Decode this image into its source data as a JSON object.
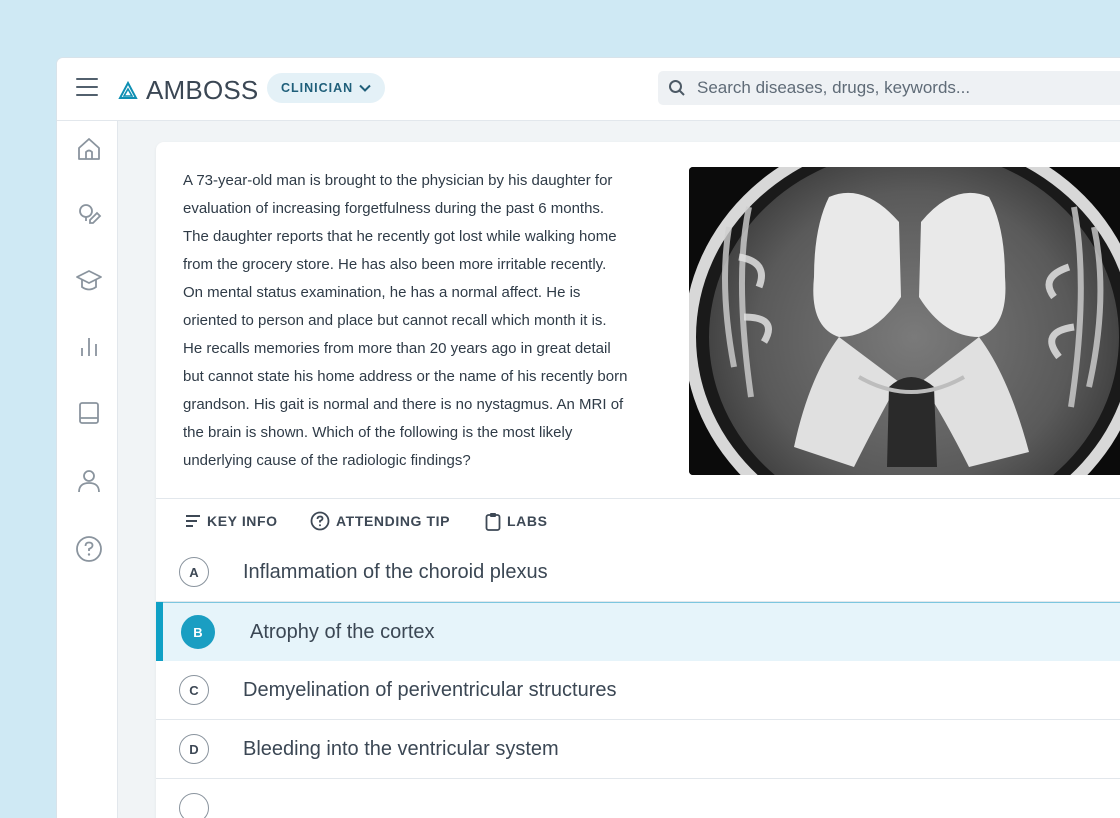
{
  "header": {
    "brand": "AMBOSS",
    "role": "CLINICIAN",
    "search_placeholder": "Search diseases, drugs, keywords..."
  },
  "sidebar": {
    "items": [
      {
        "icon": "home-icon"
      },
      {
        "icon": "stethoscope-icon"
      },
      {
        "icon": "graduation-cap-icon"
      },
      {
        "icon": "bar-chart-icon"
      },
      {
        "icon": "book-icon"
      },
      {
        "icon": "user-icon"
      },
      {
        "icon": "help-icon"
      }
    ]
  },
  "question": {
    "lines": [
      "A 73-year-old man is brought to the physician by his daughter for",
      "evaluation of increasing forgetfulness during the past 6 months.",
      "The daughter reports that he recently got lost while walking home",
      "from the grocery store. He has also been more irritable recently.",
      "On mental status examination, he has a normal affect. He is",
      "oriented to person and place but cannot recall which month it is.",
      "He recalls memories from more than 20 years ago in great detail",
      "but cannot state his home address or the name of his recently born",
      "grandson. His gait is normal and there is no nystagmus. An MRI of",
      "the brain is shown. Which of the following is the most likely",
      "underlying cause of the radiologic findings?"
    ]
  },
  "toolbar": {
    "key_info": "KEY INFO",
    "attending_tip": "ATTENDING TIP",
    "labs": "LABS"
  },
  "answers": [
    {
      "letter": "A",
      "text": "Inflammation of the choroid plexus",
      "selected": false
    },
    {
      "letter": "B",
      "text": "Atrophy of the cortex",
      "selected": true
    },
    {
      "letter": "C",
      "text": "Demyelination of periventricular structures",
      "selected": false
    },
    {
      "letter": "D",
      "text": "Bleeding into the ventricular system",
      "selected": false
    }
  ],
  "colors": {
    "accent": "#1a9ec2",
    "selected_bg": "#e6f4fa",
    "page_bg": "#cfe9f4"
  }
}
